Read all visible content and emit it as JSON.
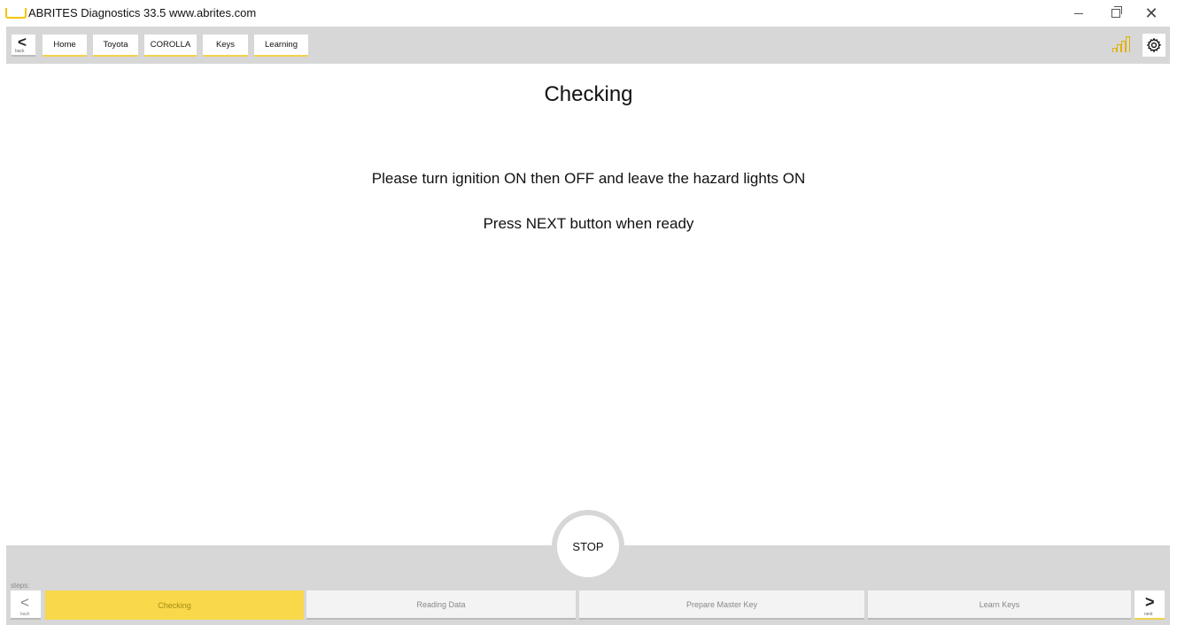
{
  "window": {
    "title": "ABRITES Diagnostics 33.5   www.abrites.com",
    "minimize": "",
    "restore": "",
    "close": "✕"
  },
  "toolbar": {
    "back_chevron": "<",
    "back_label": "back",
    "breadcrumbs": [
      "Home",
      "Toyota",
      "COROLLA",
      "Keys",
      "Learning"
    ]
  },
  "main": {
    "title": "Checking",
    "message_1": "Please turn ignition ON then OFF and leave the hazard lights ON",
    "message_2": "Press NEXT button when ready",
    "stop_label": "STOP"
  },
  "steps": {
    "label": "steps:",
    "back_chevron": "<",
    "back_label": "back",
    "items": [
      "Checking",
      "Reading Data",
      "Prepare Master Key",
      "Learn Keys"
    ],
    "active_index": 0,
    "next_chevron": ">",
    "next_label": "next"
  },
  "colors": {
    "accent": "#f9d84a",
    "bar_gray": "#d7d7d7",
    "signal": "#e0b100"
  }
}
